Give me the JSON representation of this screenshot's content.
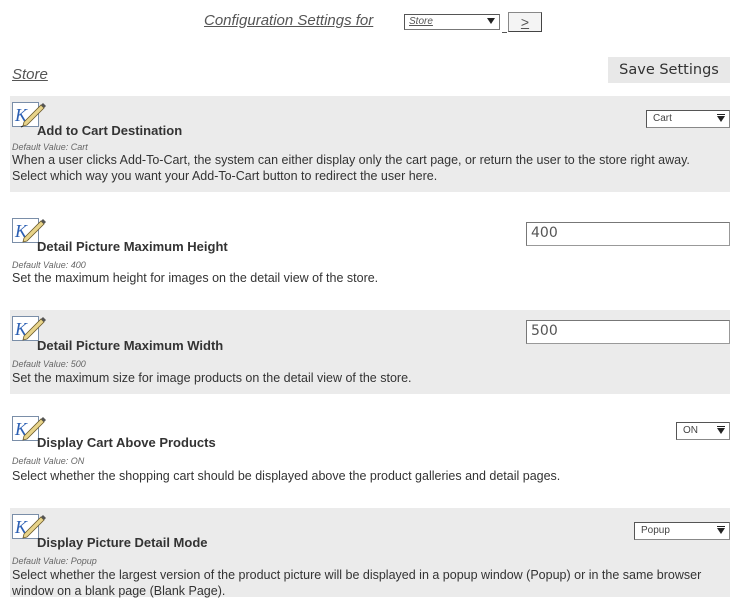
{
  "header": {
    "config_title": "Configuration Settings for",
    "store_select_value": "Store",
    "go_label": ">"
  },
  "section": {
    "store_link": "Store",
    "save_label": "Save Settings"
  },
  "settings": [
    {
      "title": "Add to Cart Destination",
      "default": "Default Value: Cart",
      "description": "When a user clicks Add-To-Cart, the system can either display only the cart page, or return the user to the store right away. Select which way you want your Add-To-Cart button to redirect the user here.",
      "control": "select",
      "value": "Cart"
    },
    {
      "title": "Detail Picture Maximum Height",
      "default": "Default Value: 400",
      "description": "Set the maximum height for images on the detail view of the store.",
      "control": "text",
      "value": "400"
    },
    {
      "title": "Detail Picture Maximum Width",
      "default": "Default Value: 500",
      "description": "Set the maximum size for image products on the detail view of the store.",
      "control": "text",
      "value": "500"
    },
    {
      "title": "Display Cart Above Products",
      "default": "Default Value: ON",
      "description": "Select whether the shopping cart should be displayed above the product galleries and detail pages.",
      "control": "select",
      "value": "ON"
    },
    {
      "title": "Display Picture Detail Mode",
      "default": "Default Value: Popup",
      "description": "Select whether the largest version of the product picture will be displayed in a popup window (Popup) or in the same browser window on a blank page (Blank Page).",
      "control": "select",
      "value": "Popup"
    }
  ],
  "icons": {
    "edit": "pen-edit-icon"
  }
}
